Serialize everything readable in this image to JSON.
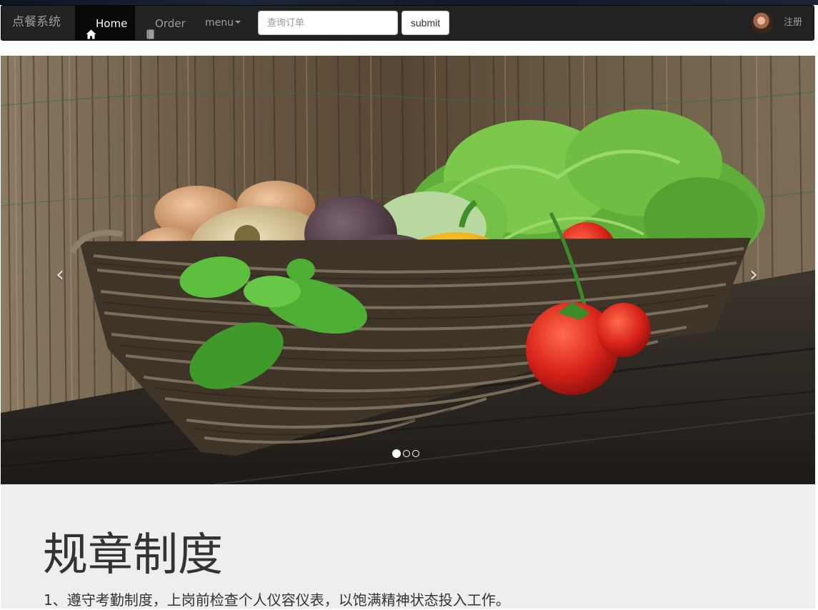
{
  "navbar": {
    "brand": "点餐系统",
    "items": [
      {
        "label": "Home",
        "icon": "home-icon",
        "active": true
      },
      {
        "label": "Order",
        "icon": "book-icon",
        "active": false
      }
    ],
    "menu_label": "menu",
    "search": {
      "placeholder": "查询订单",
      "value": ""
    },
    "submit_label": "submit",
    "register_label": "注册"
  },
  "carousel": {
    "slide_count": 3,
    "active_index": 0,
    "prev_glyph": "‹",
    "next_glyph": "›"
  },
  "jumbotron": {
    "title": "规章制度",
    "text": "1、遵守考勤制度，上岗前检查个人仪容仪表，以饱满精神状态投入工作。"
  },
  "colors": {
    "navbar_bg": "#222222",
    "navbar_active": "#080808",
    "nav_text": "#9d9d9d",
    "jumbotron_bg": "#eeeeee"
  }
}
